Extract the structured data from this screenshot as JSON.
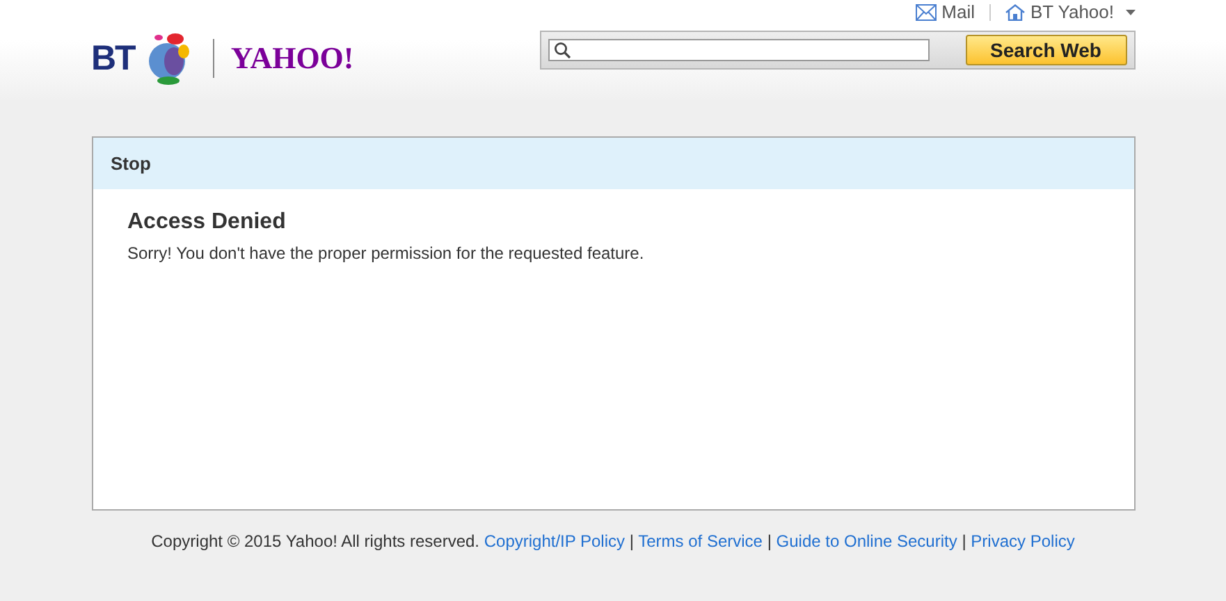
{
  "top_links": [
    {
      "kind": "mail",
      "label": "Mail"
    },
    {
      "kind": "home",
      "label": "BT Yahoo!"
    }
  ],
  "logo": {
    "left": "BT",
    "right": "YAHOO!"
  },
  "search": {
    "button": "Search Web"
  },
  "panel": {
    "header": "Stop",
    "title": "Access Denied",
    "message": "Sorry! You don't have the proper permission for the requested feature."
  },
  "footer": {
    "copyright": "Copyright © 2015 Yahoo! All rights reserved.",
    "separator": "|",
    "links": [
      "Copyright/IP Policy",
      "Terms of Service",
      "Guide to Online Security",
      "Privacy Policy"
    ]
  }
}
